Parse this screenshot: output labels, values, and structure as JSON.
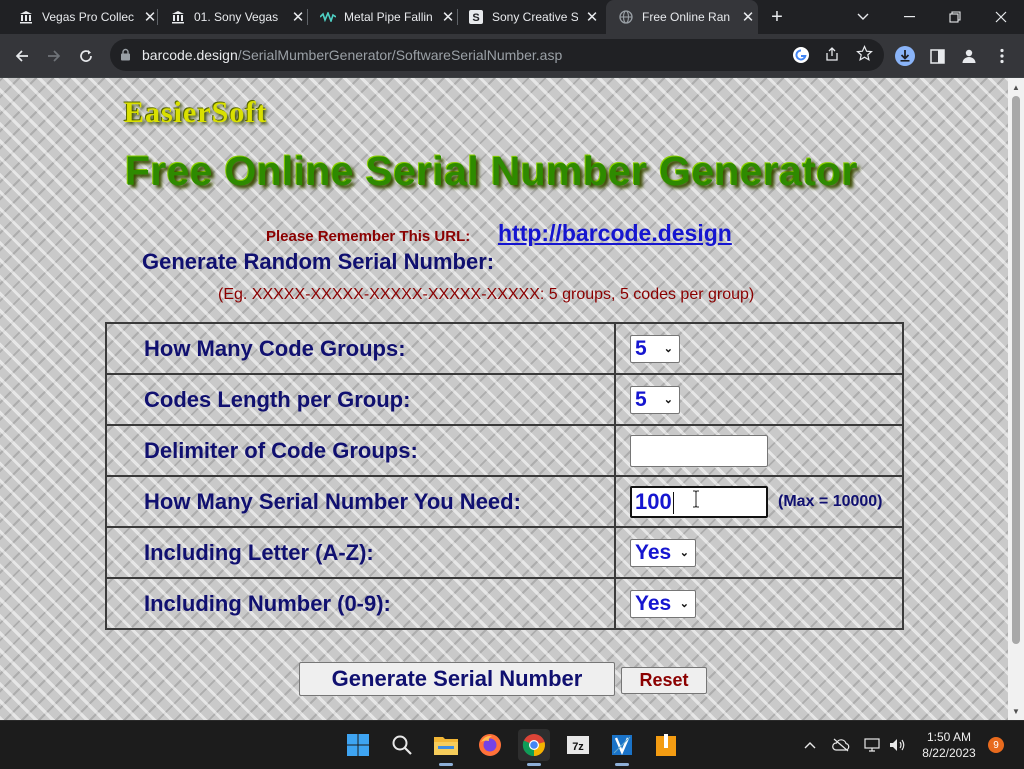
{
  "browser": {
    "tabs": [
      {
        "title": "Vegas Pro Collec",
        "icon": "bank-icon"
      },
      {
        "title": "01. Sony Vegas",
        "icon": "bank-icon"
      },
      {
        "title": "Metal Pipe Fallin",
        "icon": "waveform-icon"
      },
      {
        "title": "Sony Creative So",
        "icon": "s-logo-icon"
      },
      {
        "title": "Free Online Ran",
        "icon": "globe-icon",
        "active": true
      }
    ],
    "url_host": "barcode.design",
    "url_path": "/SerialMumberGenerator/SoftwareSerialNumber.asp"
  },
  "page": {
    "brand": "EasierSoft",
    "headline": "Free Online Serial Number Generator",
    "remember_label": "Please Remember This URL:",
    "remember_url": "http://barcode.design",
    "section_heading": "Generate Random Serial Number:",
    "example": "(Eg. XXXXX-XXXXX-XXXXX-XXXXX-XXXXX:  5 groups, 5 codes per group)",
    "rows": {
      "groups": {
        "label": "How Many Code Groups:",
        "value": "5"
      },
      "length": {
        "label": "Codes Length per Group:",
        "value": "5"
      },
      "delimiter": {
        "label": "Delimiter of Code Groups:",
        "value": ""
      },
      "count": {
        "label": "How Many Serial Number You Need:",
        "value": "100",
        "note": "(Max = 10000)"
      },
      "letters": {
        "label": "Including Letter (A-Z):",
        "value": "Yes"
      },
      "numbers": {
        "label": "Including Number (0-9):",
        "value": "Yes"
      }
    },
    "generate_button": "Generate Serial Number",
    "reset_button": "Reset"
  },
  "taskbar": {
    "time": "1:50 AM",
    "date": "8/22/2023",
    "notification_count": "9",
    "apps": [
      "windows-start-icon",
      "search-icon",
      "file-explorer-icon",
      "firefox-icon",
      "chrome-icon",
      "7zip-icon",
      "vegas-icon",
      "app-orange-icon"
    ]
  }
}
